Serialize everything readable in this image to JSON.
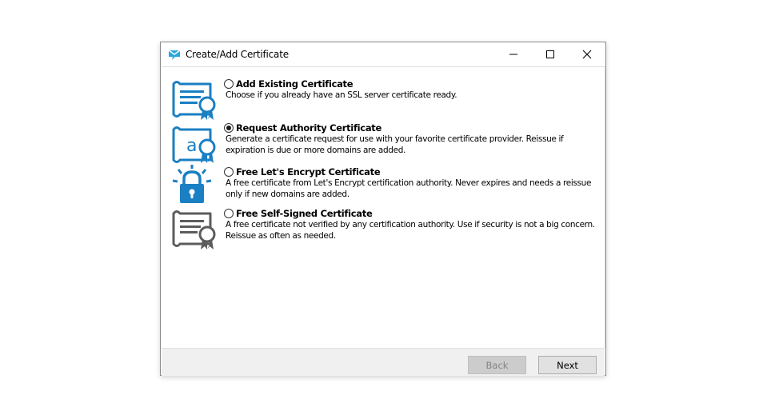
{
  "window": {
    "title": "Create/Add Certificate",
    "app_icon": "envelope-logo-icon",
    "controls": {
      "minimize": "minimize-icon",
      "maximize": "maximize-icon",
      "close": "close-icon"
    }
  },
  "options": [
    {
      "title": "Add Existing Certificate",
      "description": "Choose if you already have an SSL server certificate ready.",
      "icon": "certificate-icon",
      "checked": false
    },
    {
      "title": "Request Authority Certificate",
      "description": "Generate a certificate request for use with your favorite certificate provider. Reissue if expiration is due or more domains are added.",
      "icon": "certificate-request-icon",
      "checked": true
    },
    {
      "title": "Free Let's Encrypt Certificate",
      "description": "A free certificate from Let's Encrypt certification authority. Never expires and needs a reissue only if new domains are added.",
      "icon": "padlock-icon",
      "checked": false
    },
    {
      "title": "Free Self-Signed Certificate",
      "description": "A free certificate not verified by any certification authority. Use if security is not a big concern. Reissue as often as needed.",
      "icon": "self-signed-certificate-icon",
      "checked": false
    }
  ],
  "buttons": {
    "back": "Back",
    "next": "Next",
    "back_enabled": false
  },
  "colors": {
    "accent": "#1a7fc3",
    "icon_gray": "#5c5c5c"
  }
}
